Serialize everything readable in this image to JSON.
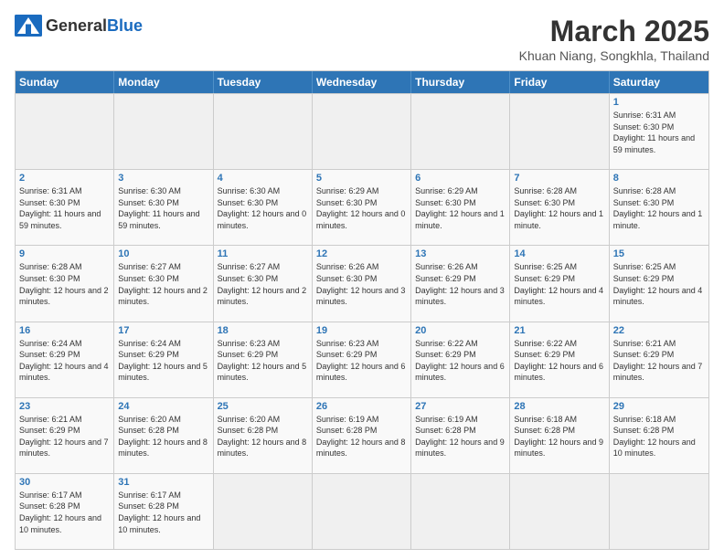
{
  "header": {
    "logo_general": "General",
    "logo_blue": "Blue",
    "month_title": "March 2025",
    "subtitle": "Khuan Niang, Songkhla, Thailand"
  },
  "weekdays": [
    "Sunday",
    "Monday",
    "Tuesday",
    "Wednesday",
    "Thursday",
    "Friday",
    "Saturday"
  ],
  "rows": [
    [
      {
        "day": "",
        "info": ""
      },
      {
        "day": "",
        "info": ""
      },
      {
        "day": "",
        "info": ""
      },
      {
        "day": "",
        "info": ""
      },
      {
        "day": "",
        "info": ""
      },
      {
        "day": "",
        "info": ""
      },
      {
        "day": "1",
        "info": "Sunrise: 6:31 AM\nSunset: 6:30 PM\nDaylight: 11 hours and 59 minutes."
      }
    ],
    [
      {
        "day": "2",
        "info": "Sunrise: 6:31 AM\nSunset: 6:30 PM\nDaylight: 11 hours and 59 minutes."
      },
      {
        "day": "3",
        "info": "Sunrise: 6:30 AM\nSunset: 6:30 PM\nDaylight: 11 hours and 59 minutes."
      },
      {
        "day": "4",
        "info": "Sunrise: 6:30 AM\nSunset: 6:30 PM\nDaylight: 12 hours and 0 minutes."
      },
      {
        "day": "5",
        "info": "Sunrise: 6:29 AM\nSunset: 6:30 PM\nDaylight: 12 hours and 0 minutes."
      },
      {
        "day": "6",
        "info": "Sunrise: 6:29 AM\nSunset: 6:30 PM\nDaylight: 12 hours and 1 minute."
      },
      {
        "day": "7",
        "info": "Sunrise: 6:28 AM\nSunset: 6:30 PM\nDaylight: 12 hours and 1 minute."
      },
      {
        "day": "8",
        "info": "Sunrise: 6:28 AM\nSunset: 6:30 PM\nDaylight: 12 hours and 1 minute."
      }
    ],
    [
      {
        "day": "9",
        "info": "Sunrise: 6:28 AM\nSunset: 6:30 PM\nDaylight: 12 hours and 2 minutes."
      },
      {
        "day": "10",
        "info": "Sunrise: 6:27 AM\nSunset: 6:30 PM\nDaylight: 12 hours and 2 minutes."
      },
      {
        "day": "11",
        "info": "Sunrise: 6:27 AM\nSunset: 6:30 PM\nDaylight: 12 hours and 2 minutes."
      },
      {
        "day": "12",
        "info": "Sunrise: 6:26 AM\nSunset: 6:30 PM\nDaylight: 12 hours and 3 minutes."
      },
      {
        "day": "13",
        "info": "Sunrise: 6:26 AM\nSunset: 6:29 PM\nDaylight: 12 hours and 3 minutes."
      },
      {
        "day": "14",
        "info": "Sunrise: 6:25 AM\nSunset: 6:29 PM\nDaylight: 12 hours and 4 minutes."
      },
      {
        "day": "15",
        "info": "Sunrise: 6:25 AM\nSunset: 6:29 PM\nDaylight: 12 hours and 4 minutes."
      }
    ],
    [
      {
        "day": "16",
        "info": "Sunrise: 6:24 AM\nSunset: 6:29 PM\nDaylight: 12 hours and 4 minutes."
      },
      {
        "day": "17",
        "info": "Sunrise: 6:24 AM\nSunset: 6:29 PM\nDaylight: 12 hours and 5 minutes."
      },
      {
        "day": "18",
        "info": "Sunrise: 6:23 AM\nSunset: 6:29 PM\nDaylight: 12 hours and 5 minutes."
      },
      {
        "day": "19",
        "info": "Sunrise: 6:23 AM\nSunset: 6:29 PM\nDaylight: 12 hours and 6 minutes."
      },
      {
        "day": "20",
        "info": "Sunrise: 6:22 AM\nSunset: 6:29 PM\nDaylight: 12 hours and 6 minutes."
      },
      {
        "day": "21",
        "info": "Sunrise: 6:22 AM\nSunset: 6:29 PM\nDaylight: 12 hours and 6 minutes."
      },
      {
        "day": "22",
        "info": "Sunrise: 6:21 AM\nSunset: 6:29 PM\nDaylight: 12 hours and 7 minutes."
      }
    ],
    [
      {
        "day": "23",
        "info": "Sunrise: 6:21 AM\nSunset: 6:29 PM\nDaylight: 12 hours and 7 minutes."
      },
      {
        "day": "24",
        "info": "Sunrise: 6:20 AM\nSunset: 6:28 PM\nDaylight: 12 hours and 8 minutes."
      },
      {
        "day": "25",
        "info": "Sunrise: 6:20 AM\nSunset: 6:28 PM\nDaylight: 12 hours and 8 minutes."
      },
      {
        "day": "26",
        "info": "Sunrise: 6:19 AM\nSunset: 6:28 PM\nDaylight: 12 hours and 8 minutes."
      },
      {
        "day": "27",
        "info": "Sunrise: 6:19 AM\nSunset: 6:28 PM\nDaylight: 12 hours and 9 minutes."
      },
      {
        "day": "28",
        "info": "Sunrise: 6:18 AM\nSunset: 6:28 PM\nDaylight: 12 hours and 9 minutes."
      },
      {
        "day": "29",
        "info": "Sunrise: 6:18 AM\nSunset: 6:28 PM\nDaylight: 12 hours and 10 minutes."
      }
    ],
    [
      {
        "day": "30",
        "info": "Sunrise: 6:17 AM\nSunset: 6:28 PM\nDaylight: 12 hours and 10 minutes."
      },
      {
        "day": "31",
        "info": "Sunrise: 6:17 AM\nSunset: 6:28 PM\nDaylight: 12 hours and 10 minutes."
      },
      {
        "day": "",
        "info": ""
      },
      {
        "day": "",
        "info": ""
      },
      {
        "day": "",
        "info": ""
      },
      {
        "day": "",
        "info": ""
      },
      {
        "day": "",
        "info": ""
      }
    ]
  ]
}
